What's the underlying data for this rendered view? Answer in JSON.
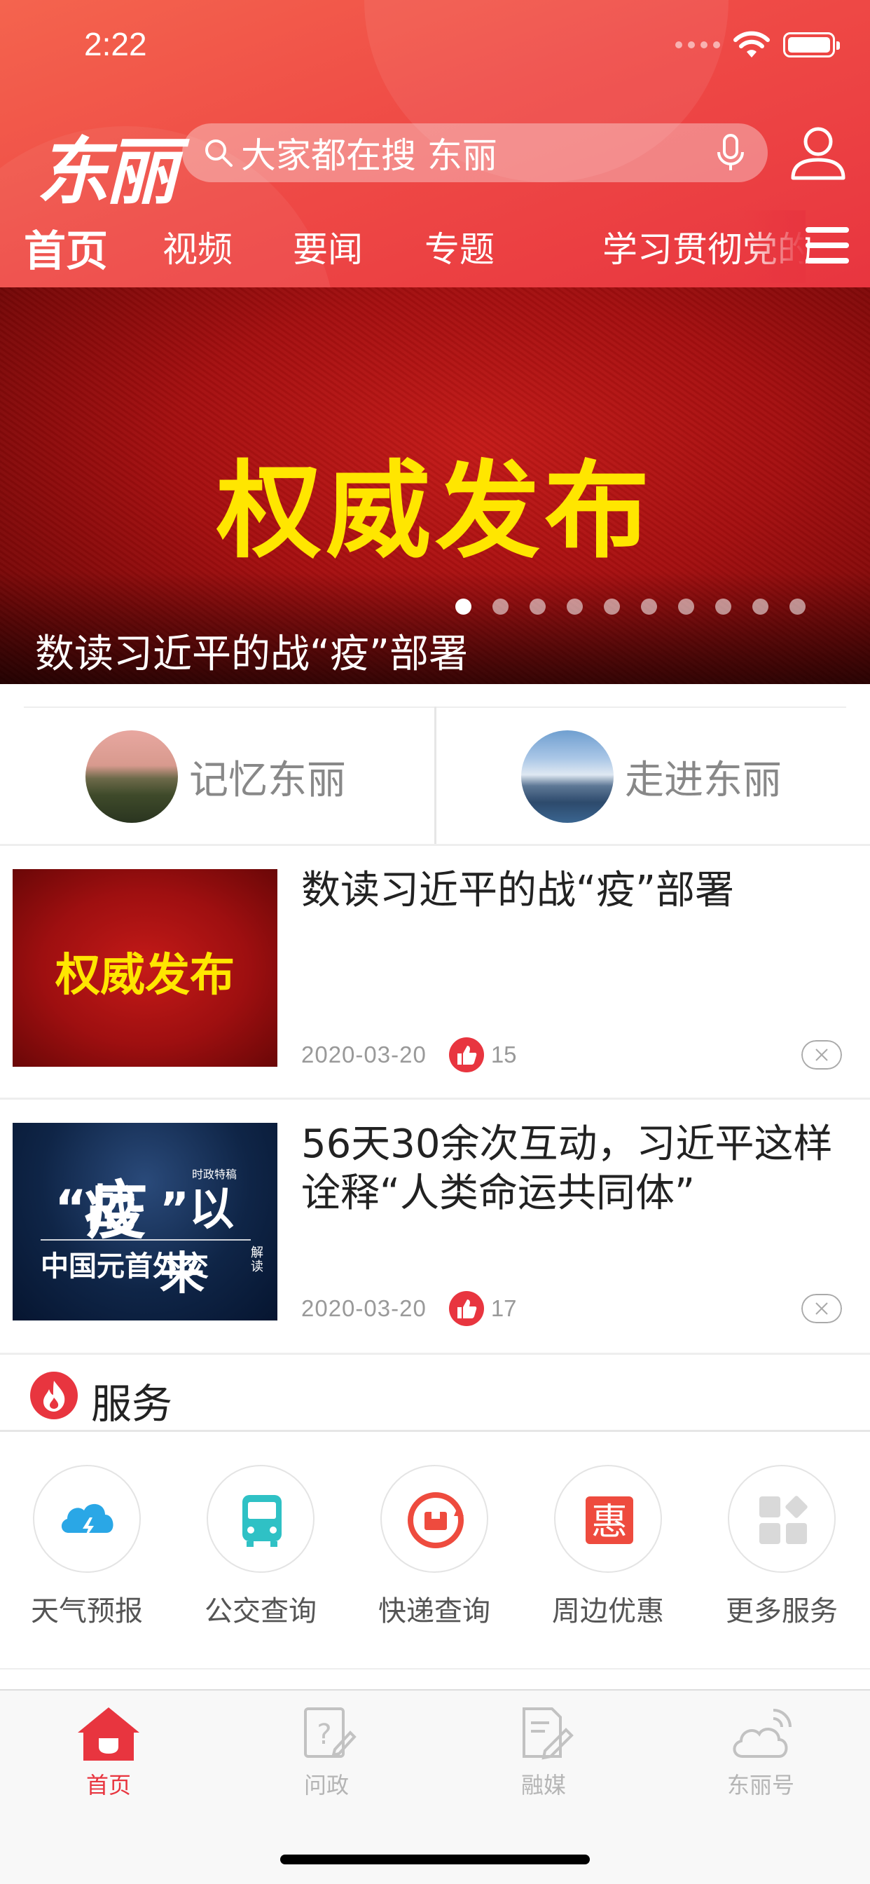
{
  "status_bar": {
    "time": "2:22"
  },
  "header": {
    "logo_text": "东丽",
    "search_placeholder": "大家都在搜 东丽",
    "nav_tabs": [
      "首页",
      "视频",
      "要闻",
      "专题",
      "学习贯彻党的"
    ],
    "active_tab": 0
  },
  "banner": {
    "headline": "权威发布",
    "caption": "数读习近平的战“疫”部署",
    "page_count": 10,
    "current_page": 1
  },
  "features": [
    {
      "label": "记忆东丽"
    },
    {
      "label": "走进东丽"
    }
  ],
  "news": [
    {
      "title": "数读习近平的战“疫”部署",
      "date": "2020-03-20",
      "likes": "15",
      "thumb_text": "权威发布"
    },
    {
      "title": "56天30余次互动，习近平这样诠释“人类命运共同体”",
      "date": "2020-03-20",
      "likes": "17",
      "thumb_lines": {
        "zhan": "“战",
        "yi": "疫",
        "yilai": "”以来",
        "tag": "时政特稿",
        "bottom": "中国元首外交",
        "jiedu": "解读"
      }
    }
  ],
  "services": {
    "title": "服务",
    "items": [
      {
        "label": "天气预报",
        "icon": "weather-icon"
      },
      {
        "label": "公交查询",
        "icon": "bus-icon"
      },
      {
        "label": "快递查询",
        "icon": "express-icon"
      },
      {
        "label": "周边优惠",
        "icon": "discount-icon",
        "glyph": "惠"
      },
      {
        "label": "更多服务",
        "icon": "more-services-icon"
      }
    ]
  },
  "tabbar": [
    {
      "label": "首页",
      "active": true
    },
    {
      "label": "问政",
      "active": false
    },
    {
      "label": "融媒",
      "active": false
    },
    {
      "label": "东丽号",
      "active": false
    }
  ],
  "colors": {
    "brand_red": "#e8353f",
    "headline_yellow": "#ffe600"
  }
}
